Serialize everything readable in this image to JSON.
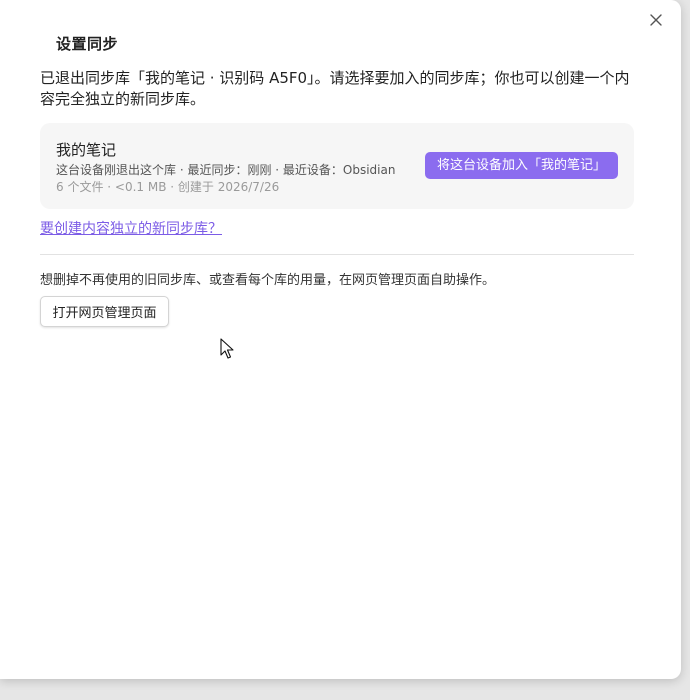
{
  "dialog": {
    "title": "设置同步",
    "description": "已退出同步库「我的笔记 · 识别码 A5F0」。请选择要加入的同步库；你也可以创建一个内容完全独立的新同步库。",
    "close_icon": "close-icon"
  },
  "vault_card": {
    "name": "我的笔记",
    "meta": "这台设备刚退出这个库 · 最近同步：刚刚 · 最近设备：Obsidian",
    "stats": "6 个文件 · <0.1 MB · 创建于 2026/7/26",
    "join_label": "将这台设备加入「我的笔记」"
  },
  "create_link": "要创建内容独立的新同步库？",
  "manage": {
    "text": "想删掉不再使用的旧同步库、或查看每个库的用量，在网页管理页面自助操作。",
    "button_label": "打开网页管理页面"
  },
  "colors": {
    "accent": "#8b6cef",
    "link": "#7c5ce6",
    "card_bg": "#f6f6f6"
  }
}
